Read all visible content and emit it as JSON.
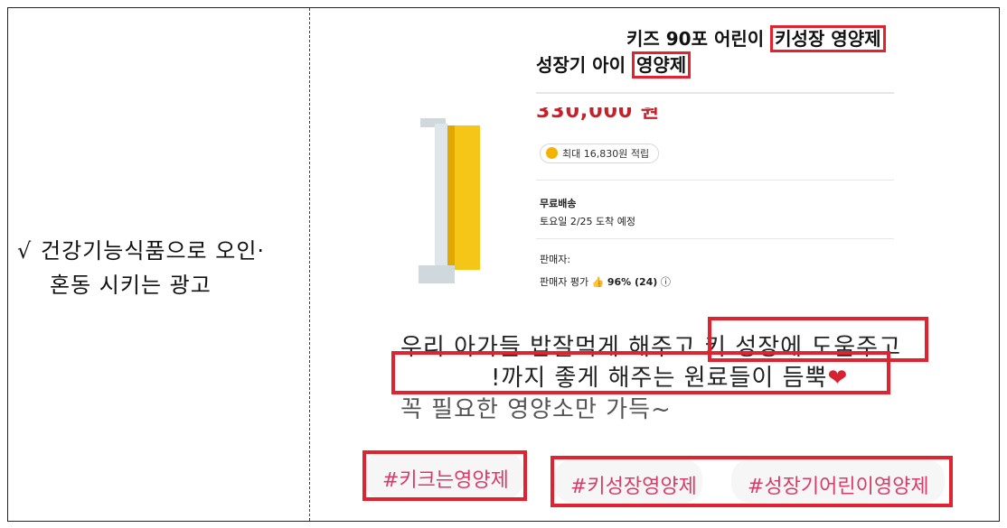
{
  "left": {
    "bullet": "√",
    "line1": "건강기능식품으로 오인·",
    "line2": "혼동 시키는 광고"
  },
  "product": {
    "title_line1": "키즈 90포 어린이 ",
    "title_line1_highlight": "키성장 영양제",
    "title_line2": "성장기 아이 ",
    "title_line2_highlight": "영양제",
    "price": "330,000 원",
    "points": "최대 16,830원 적립",
    "shipping_label": "무료배송",
    "delivery": "토요일 2/25 도착 예정",
    "seller_label": "판매자:",
    "seller_rating_label": "판매자 평가",
    "seller_rating_value": "96% (24)"
  },
  "ad_copy": {
    "line1_a": "우리 아가들 밥잘먹게 해주고 ",
    "line1_b": "키 성장에 도움주고",
    "line2": "!까지 좋게 해주는 원료들이 듬뿍",
    "line3": "꼭 필요한 영양소만 가득~"
  },
  "hashtags": {
    "tag1": "#키크는영양제",
    "tag2": "#키성장영양제",
    "tag3": "#성장기어린이영양제"
  },
  "colors": {
    "highlight_border": "#e0232e",
    "hashtag": "#d83b6a",
    "price": "#c8202a"
  }
}
